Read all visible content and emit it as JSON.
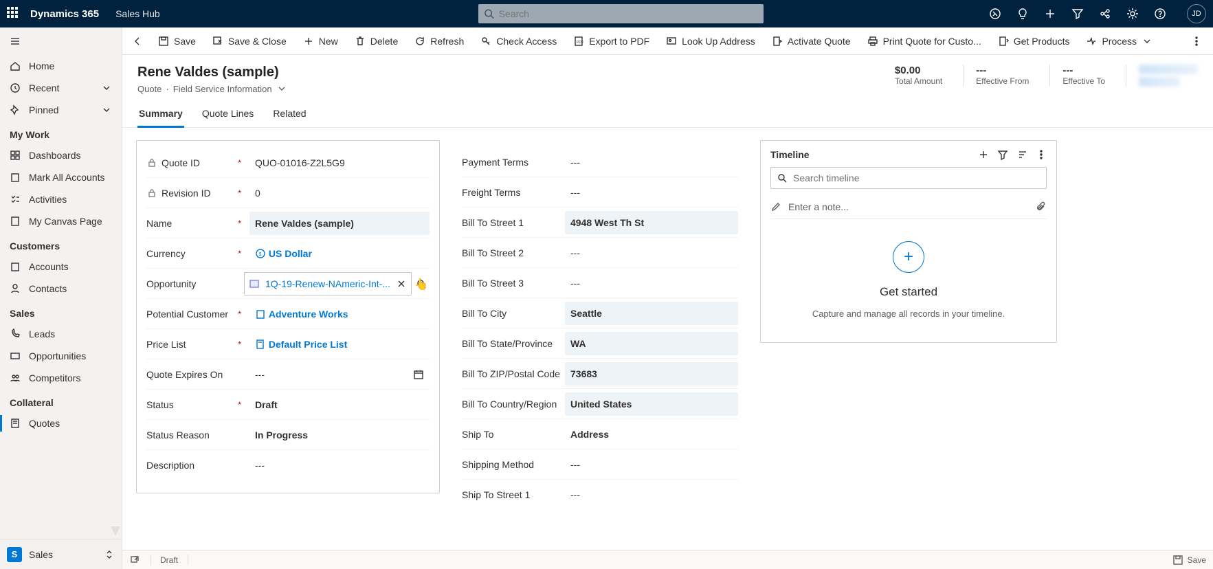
{
  "top": {
    "brand": "Dynamics 365",
    "hub": "Sales Hub",
    "search_placeholder": "Search",
    "avatar": "JD"
  },
  "sidebar": {
    "home": "Home",
    "recent": "Recent",
    "pinned": "Pinned",
    "groups": {
      "mywork": {
        "title": "My Work",
        "items": [
          "Dashboards",
          "Mark All Accounts",
          "Activities",
          "My Canvas Page"
        ]
      },
      "customers": {
        "title": "Customers",
        "items": [
          "Accounts",
          "Contacts"
        ]
      },
      "sales": {
        "title": "Sales",
        "items": [
          "Leads",
          "Opportunities",
          "Competitors"
        ]
      },
      "collateral": {
        "title": "Collateral",
        "items": [
          "Quotes"
        ]
      }
    },
    "area": {
      "badge": "S",
      "label": "Sales"
    }
  },
  "cmd": {
    "save": "Save",
    "saveclose": "Save & Close",
    "new": "New",
    "delete": "Delete",
    "refresh": "Refresh",
    "check": "Check Access",
    "pdf": "Export to PDF",
    "lookup": "Look Up Address",
    "activate": "Activate Quote",
    "print": "Print Quote for Custo...",
    "getprod": "Get Products",
    "process": "Process"
  },
  "hdr": {
    "title": "Rene Valdes (sample)",
    "entity": "Quote",
    "form": "Field Service Information",
    "stats": {
      "total_val": "$0.00",
      "total_lbl": "Total Amount",
      "from_val": "---",
      "from_lbl": "Effective From",
      "to_val": "---",
      "to_lbl": "Effective To"
    }
  },
  "tabs": {
    "summary": "Summary",
    "lines": "Quote Lines",
    "related": "Related"
  },
  "left": {
    "quoteid_lbl": "Quote ID",
    "quoteid_val": "QUO-01016-Z2L5G9",
    "rev_lbl": "Revision ID",
    "rev_val": "0",
    "name_lbl": "Name",
    "name_val": "Rene Valdes (sample)",
    "curr_lbl": "Currency",
    "curr_val": "US Dollar",
    "opp_lbl": "Opportunity",
    "opp_val": "1Q-19-Renew-NAmeric-Int-...",
    "cust_lbl": "Potential Customer",
    "cust_val": "Adventure Works",
    "price_lbl": "Price List",
    "price_val": "Default Price List",
    "exp_lbl": "Quote Expires On",
    "exp_val": "---",
    "status_lbl": "Status",
    "status_val": "Draft",
    "reason_lbl": "Status Reason",
    "reason_val": "In Progress",
    "desc_lbl": "Description",
    "desc_val": "---"
  },
  "right": {
    "pay_lbl": "Payment Terms",
    "pay_val": "---",
    "freight_lbl": "Freight Terms",
    "freight_val": "---",
    "s1_lbl": "Bill To Street 1",
    "s1_val": "4948 West Th St",
    "s2_lbl": "Bill To Street 2",
    "s2_val": "---",
    "s3_lbl": "Bill To Street 3",
    "s3_val": "---",
    "city_lbl": "Bill To City",
    "city_val": "Seattle",
    "state_lbl": "Bill To State/Province",
    "state_val": "WA",
    "zip_lbl": "Bill To ZIP/Postal Code",
    "zip_val": "73683",
    "cr_lbl": "Bill To Country/Region",
    "cr_val": "United States",
    "ship_lbl": "Ship To",
    "ship_val": "Address",
    "method_lbl": "Shipping Method",
    "method_val": "---",
    "ss1_lbl": "Ship To Street 1",
    "ss1_val": "---"
  },
  "timeline": {
    "title": "Timeline",
    "search_placeholder": "Search timeline",
    "note_placeholder": "Enter a note...",
    "get_started": "Get started",
    "sub": "Capture and manage all records in your timeline."
  },
  "status": {
    "draft": "Draft",
    "save": "Save"
  }
}
